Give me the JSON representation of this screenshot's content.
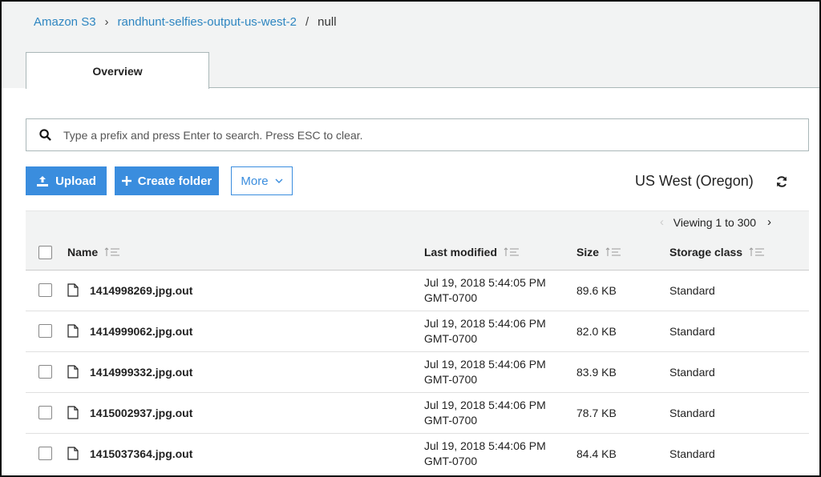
{
  "breadcrumb": {
    "root": "Amazon S3",
    "bucket": "randhunt-selfies-output-us-west-2",
    "path": "null"
  },
  "tabs": [
    {
      "label": "Overview"
    }
  ],
  "search": {
    "placeholder": "Type a prefix and press Enter to search. Press ESC to clear.",
    "value": ""
  },
  "toolbar": {
    "upload_label": "Upload",
    "create_folder_label": "Create folder",
    "more_label": "More",
    "region_label": "US West (Oregon)"
  },
  "pagination": {
    "text": "Viewing 1 to 300"
  },
  "columns": {
    "name": "Name",
    "last_modified": "Last modified",
    "size": "Size",
    "storage_class": "Storage class"
  },
  "rows": [
    {
      "name": "1414998269.jpg.out",
      "date": "Jul 19, 2018 5:44:05 PM",
      "tz": "GMT-0700",
      "size": "89.6 KB",
      "storage_class": "Standard"
    },
    {
      "name": "1414999062.jpg.out",
      "date": "Jul 19, 2018 5:44:06 PM",
      "tz": "GMT-0700",
      "size": "82.0 KB",
      "storage_class": "Standard"
    },
    {
      "name": "1414999332.jpg.out",
      "date": "Jul 19, 2018 5:44:06 PM",
      "tz": "GMT-0700",
      "size": "83.9 KB",
      "storage_class": "Standard"
    },
    {
      "name": "1415002937.jpg.out",
      "date": "Jul 19, 2018 5:44:06 PM",
      "tz": "GMT-0700",
      "size": "78.7 KB",
      "storage_class": "Standard"
    },
    {
      "name": "1415037364.jpg.out",
      "date": "Jul 19, 2018 5:44:06 PM",
      "tz": "GMT-0700",
      "size": "84.4 KB",
      "storage_class": "Standard"
    }
  ],
  "colors": {
    "accent": "#3a8dde",
    "link": "#2e86c1",
    "header_bg": "#f2f3f3"
  }
}
